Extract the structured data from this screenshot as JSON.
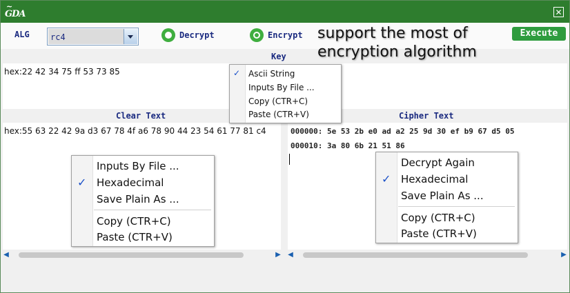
{
  "window": {
    "logo_text": "GDA",
    "close_icon": "close-icon"
  },
  "toolbar": {
    "alg_label": "ALG",
    "alg_value": "rc4",
    "decrypt_label": "Decrypt",
    "encrypt_label": "Encrypt",
    "encrypt_selected": true,
    "annotation_line1": "support the most of",
    "annotation_line2": "encryption algorithm",
    "execute_label": "Execute"
  },
  "key": {
    "title": "Key",
    "value": "hex:22 42 34 75 ff 53 73 85",
    "menu": {
      "items": [
        {
          "label": "Ascii String",
          "checked": true
        },
        {
          "label": "Inputs By File ...",
          "checked": false
        },
        {
          "label": "Copy (CTR+C)",
          "checked": false
        },
        {
          "label": "Paste (CTR+V)",
          "checked": false
        }
      ]
    }
  },
  "clear": {
    "title": "Clear Text",
    "value": "hex:55 63 22 42 9a d3 67 78 4f a6 78 90 44 23 54 61 77 81 c4",
    "menu": {
      "items": [
        {
          "label": "Inputs By File ...",
          "checked": false
        },
        {
          "label": "Hexadecimal",
          "checked": true
        },
        {
          "label": "Save Plain As ...",
          "checked": false
        },
        {
          "label": "Copy (CTR+C)",
          "checked": false
        },
        {
          "label": "Paste (CTR+V)",
          "checked": false
        }
      ]
    }
  },
  "cipher": {
    "title": "Cipher Text",
    "lines": [
      "000000: 5e 53 2b e0 ad a2 25 9d 30 ef b9 67 d5 05",
      "000010: 3a 80 6b 21 51 86"
    ],
    "menu": {
      "items": [
        {
          "label": "Decrypt Again",
          "checked": false
        },
        {
          "label": "Hexadecimal",
          "checked": true
        },
        {
          "label": "Save Plain As ...",
          "checked": false
        },
        {
          "label": "Copy (CTR+C)",
          "checked": false
        },
        {
          "label": "Paste (CTR+V)",
          "checked": false
        }
      ]
    }
  },
  "colors": {
    "titlebar": "#2e7d2e",
    "accent_green": "#3fae3f",
    "label_blue": "#1a2a80",
    "check_blue": "#1a50c8"
  },
  "icons": {
    "check": "check-icon",
    "scroll_left": "scroll-left-icon",
    "scroll_right": "scroll-right-icon",
    "dropdown": "chevron-down-icon"
  }
}
